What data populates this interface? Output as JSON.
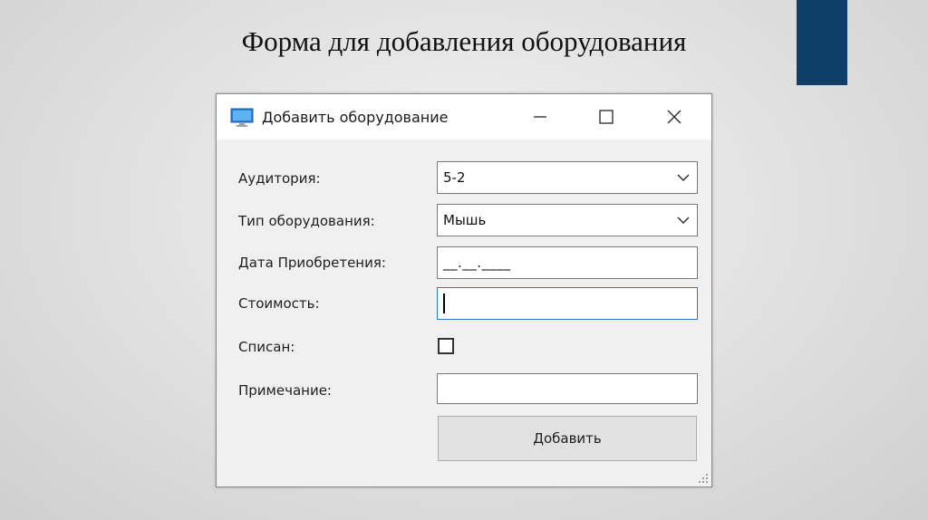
{
  "slide": {
    "title": "Форма для добавления оборудования"
  },
  "window": {
    "title": "Добавить оборудование"
  },
  "form": {
    "auditorium": {
      "label": "Аудитория:",
      "value": "5-2"
    },
    "equipment_type": {
      "label": "Тип оборудования:",
      "value": "Мышь"
    },
    "purchase_date": {
      "label": "Дата Приобретения:",
      "value": "__.__.____"
    },
    "cost": {
      "label": "Стоимость:",
      "value": ""
    },
    "written_off": {
      "label": "Списан:",
      "checked": false
    },
    "note": {
      "label": "Примечание:",
      "value": ""
    },
    "submit_label": "Добавить"
  },
  "colors": {
    "accent_bar": "#0f3f68",
    "focus_border": "#2a78c8"
  },
  "icons": [
    "monitor-icon",
    "minimize-icon",
    "maximize-icon",
    "close-icon",
    "chevron-down-icon",
    "resize-grip-icon"
  ]
}
